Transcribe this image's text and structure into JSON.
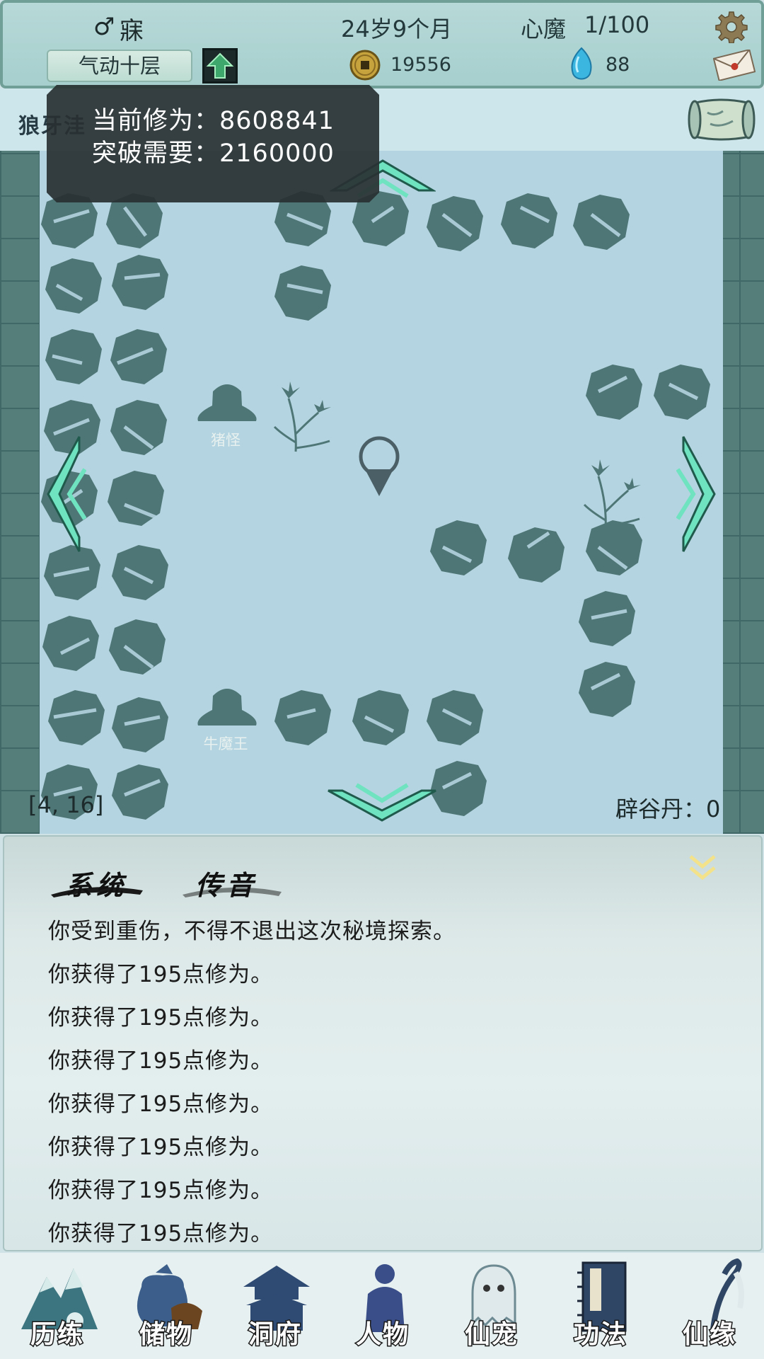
{
  "header": {
    "gender_symbol": "♂",
    "player_name": "寐",
    "age": "24岁9个月",
    "xinmo_label": "心魔",
    "xinmo_value": "1/100",
    "realm": "气动十层",
    "coins": "19556",
    "spirit_stones": "88",
    "icons": {
      "settings": "gear-icon",
      "upgrade": "up-arrow-icon",
      "coin": "copper-coin-icon",
      "gem": "spirit-stone-icon",
      "mail": "mail-icon"
    }
  },
  "location": {
    "name": "狼牙洼",
    "map_icon": "scroll-map-icon"
  },
  "tooltip": {
    "current_label": "当前修为：",
    "current_value": "8608841",
    "need_label": "突破需要：",
    "need_value": "2160000"
  },
  "map": {
    "npcs": [
      "猪怪",
      "牛魔王"
    ],
    "coord": "[4, 16]",
    "pill_label": "辟谷丹：",
    "pill_value": "0"
  },
  "log": {
    "tabs": [
      "系统",
      "传音"
    ],
    "messages": [
      "你受到重伤，不得不退出这次秘境探索。",
      "你获得了195点修为。",
      "你获得了195点修为。",
      "你获得了195点修为。",
      "你获得了195点修为。",
      "你获得了195点修为。",
      "你获得了195点修为。",
      "你获得了195点修为。"
    ]
  },
  "nav": {
    "items": [
      "历练",
      "储物",
      "洞府",
      "人物",
      "仙宠",
      "功法",
      "仙缘"
    ]
  },
  "colors": {
    "map_bg": "#b3d4e0",
    "rock": "#4f7676",
    "arrow_glow": "#6fe3c0",
    "tooltip_bg": "#283032"
  }
}
